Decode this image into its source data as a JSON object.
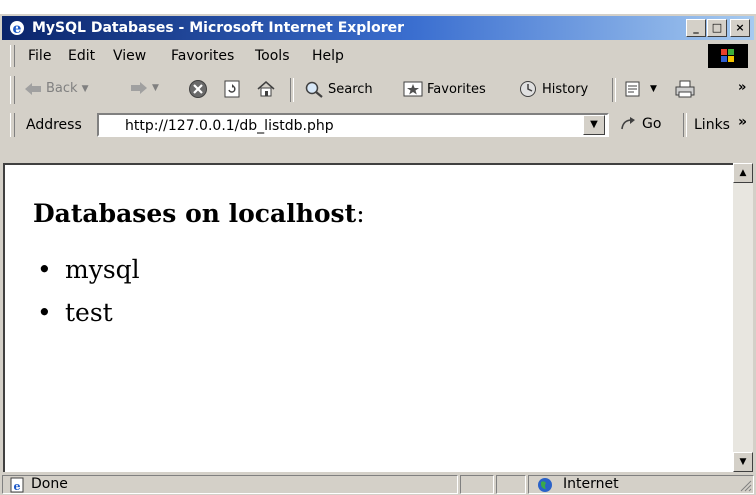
{
  "window": {
    "title": "MySQL Databases - Microsoft Internet Explorer"
  },
  "title_buttons": {
    "minimize": "_",
    "maximize": "□",
    "close": "×"
  },
  "menu": [
    "File",
    "Edit",
    "View",
    "Favorites",
    "Tools",
    "Help"
  ],
  "toolbar": {
    "back": "Back",
    "search": "Search",
    "favorites": "Favorites",
    "history": "History",
    "more": "»"
  },
  "address": {
    "label": "Address",
    "url": "http://127.0.0.1/db_listdb.php",
    "go": "Go",
    "links": "Links",
    "links_more": "»"
  },
  "page": {
    "heading_bold": "Databases on localhost",
    "heading_colon": ":",
    "databases": [
      "mysql",
      "test"
    ]
  },
  "status": {
    "text": "Done",
    "zone": "Internet"
  },
  "colors": {
    "titlebar_start": "#0a246a",
    "titlebar_end": "#a6caf0",
    "chrome": "#d4d0c8"
  }
}
